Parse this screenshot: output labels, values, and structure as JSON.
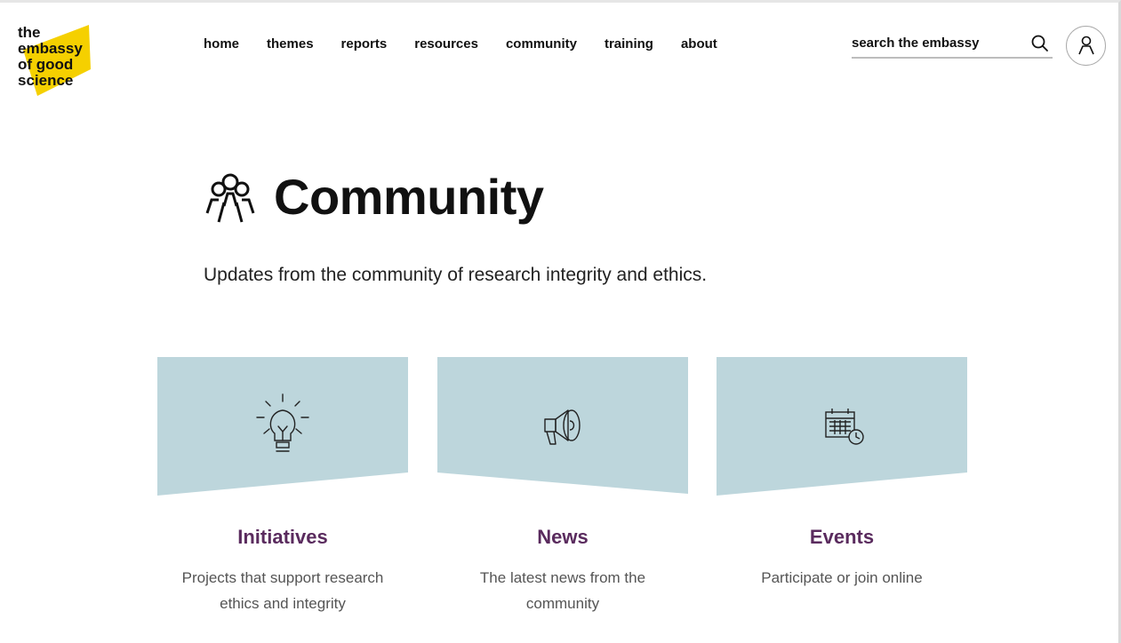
{
  "logo": {
    "line1": "the",
    "line2": "embassy",
    "line3": "of good",
    "line4": "science"
  },
  "nav": {
    "items": [
      "home",
      "themes",
      "reports",
      "resources",
      "community",
      "training",
      "about"
    ]
  },
  "search": {
    "placeholder": "search the embassy"
  },
  "icons": {
    "search": "search-icon",
    "user": "user-icon",
    "community": "community-icon"
  },
  "colors": {
    "accent": "#f5d000",
    "card_bg": "#bdd6dc",
    "card_title": "#5a2b5e"
  },
  "page": {
    "title": "Community",
    "subtitle": "Updates from the community of research integrity and ethics."
  },
  "cards": [
    {
      "title": "Initiatives",
      "desc_line1": "Projects that support research",
      "desc_line2": "ethics and integrity",
      "icon": "lightbulb-icon"
    },
    {
      "title": "News",
      "desc_line1": "The latest news from the",
      "desc_line2": "community",
      "icon": "megaphone-icon"
    },
    {
      "title": "Events",
      "desc_line1": "Participate or join online",
      "desc_line2": "",
      "icon": "calendar-icon"
    }
  ]
}
